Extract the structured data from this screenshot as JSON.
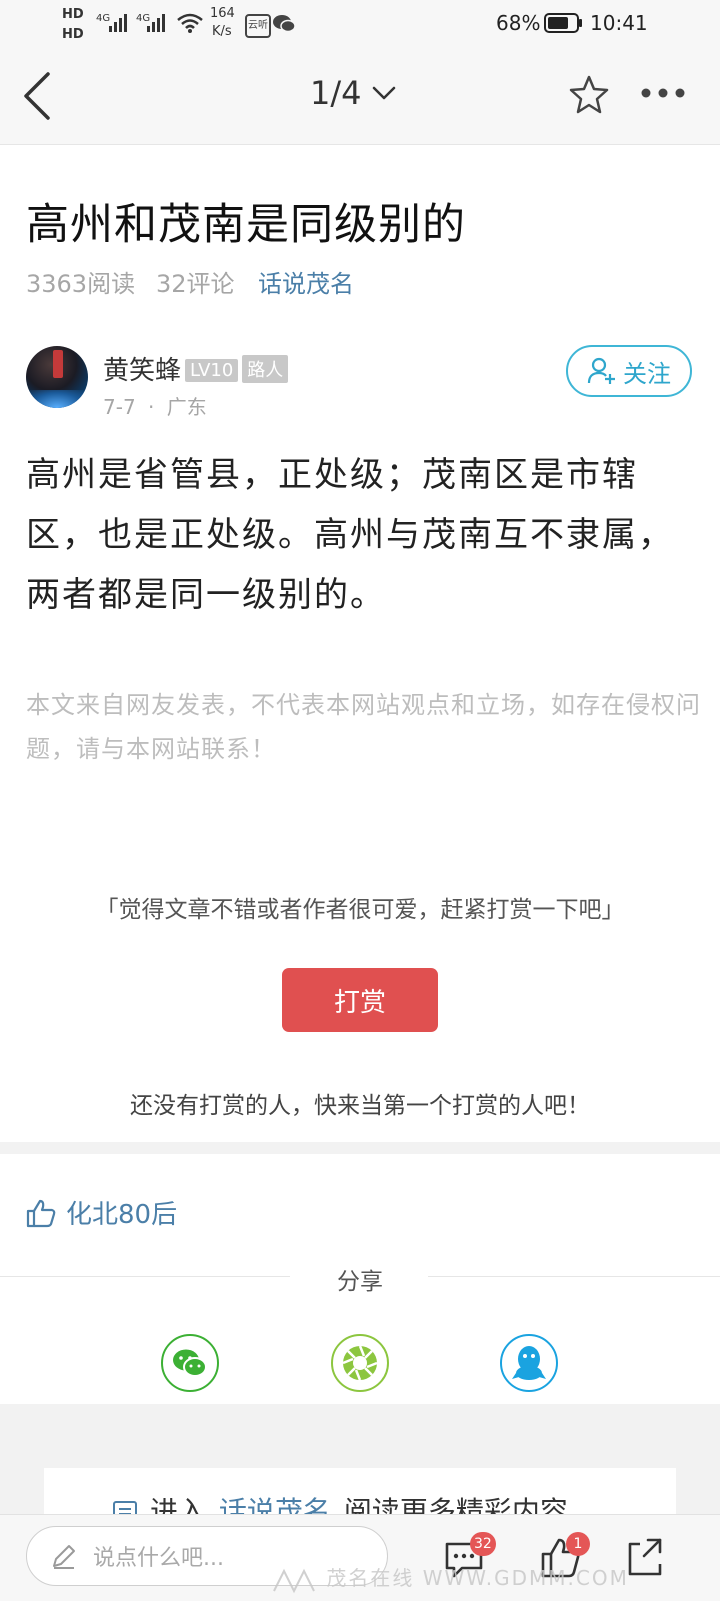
{
  "status_bar": {
    "hd1": "HD",
    "hd2": "HD",
    "sig1": "4G",
    "sig2": "4G",
    "speed_value": "164",
    "speed_unit": "K/s",
    "app_tag": "云听",
    "battery": "68%",
    "time": "10:41"
  },
  "nav": {
    "page_indicator": "1/4"
  },
  "article": {
    "title": "高州和茂南是同级别的",
    "reads": "3363阅读",
    "comments": "32评论",
    "section": "话说茂名",
    "author": {
      "name": "黄笑蜂",
      "level": "LV10",
      "rank": "路人",
      "date": "7-7",
      "separator": "·",
      "location": "广东",
      "follow_label": "关注"
    },
    "body": "高州是省管县，正处级；茂南区是市辖区，也是正处级。高州与茂南互不隶属，两者都是同一级别的。",
    "disclaimer": "本文来自网友发表，不代表本网站观点和立场，如存在侵权问题，请与本网站联系！"
  },
  "reward": {
    "prompt": "「觉得文章不错或者作者很可爱，赶紧打赏一下吧」",
    "button": "打赏",
    "none_text": "还没有打赏的人，快来当第一个打赏的人吧！"
  },
  "likes": {
    "liker": "化北80后"
  },
  "share": {
    "label": "分享",
    "icons": [
      "wechat-icon",
      "moments-icon",
      "qq-icon"
    ],
    "colors": {
      "wechat": "#3cb034",
      "moments": "#8cc63f",
      "qq": "#1aa3e0"
    }
  },
  "more": {
    "prefix": "进入",
    "link": "话说茂名",
    "suffix": "阅读更多精彩内容"
  },
  "bottom_bar": {
    "placeholder": "说点什么吧...",
    "comment_count": "32",
    "like_count": "1"
  },
  "watermark": "茂名在线 WWW.GDMM.COM",
  "colors": {
    "accent_blue": "#4b7fa8",
    "follow_cyan": "#3fb6d6",
    "reward_red": "#e05050",
    "badge_red": "#e45656"
  }
}
